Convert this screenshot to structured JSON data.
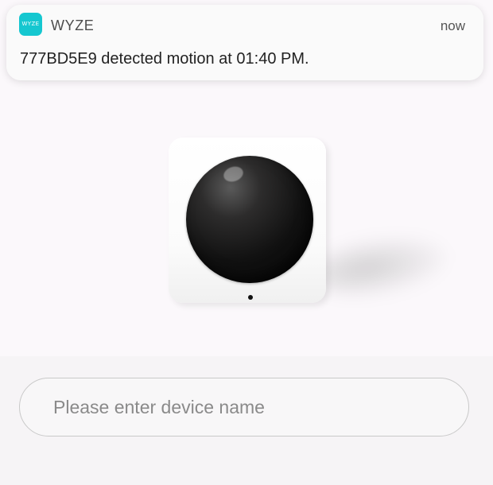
{
  "notification": {
    "app_icon_text": "WYZE",
    "app_name": "WYZE",
    "time": "now",
    "message": "777BD5E9 detected motion at 01:40 PM."
  },
  "device_setup": {
    "device_image": "motion-sensor",
    "name_input": {
      "value": "",
      "placeholder": "Please enter device name"
    }
  },
  "colors": {
    "app_icon": "#15c7d0",
    "background": "#f6f4f6",
    "notification_background": "#fafafa",
    "sensor_lens": "#111111"
  }
}
